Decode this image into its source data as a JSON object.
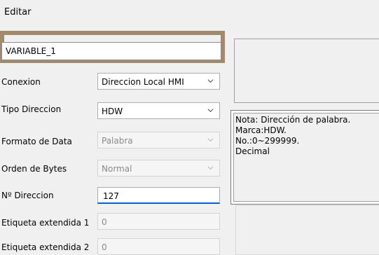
{
  "window": {
    "title": "Editar"
  },
  "name_field": {
    "value": "VARIABLE_1"
  },
  "form": {
    "conexion": {
      "label": "Conexion",
      "value": "Direccion Local HMI"
    },
    "tipo_direccion": {
      "label": "Tipo Direccion",
      "value": "HDW"
    },
    "formato_data": {
      "label": "Formato de Data",
      "value": "Palabra"
    },
    "orden_bytes": {
      "label": "Orden de Bytes",
      "value": "Normal"
    },
    "direccion": {
      "label": "Nº Direccion",
      "value": "127"
    },
    "etiqueta1": {
      "label": "Etiqueta extendida 1",
      "value": "0"
    },
    "etiqueta2": {
      "label": "Etiqueta extendida 2",
      "value": "0"
    }
  },
  "note": {
    "text": "Nota: Dirección de palabra.\nMarca:HDW.\nNo.:0~299999.\nDecimal"
  },
  "colors": {
    "frame_border": "#a18b6c",
    "focus_underline": "#0066cc"
  }
}
